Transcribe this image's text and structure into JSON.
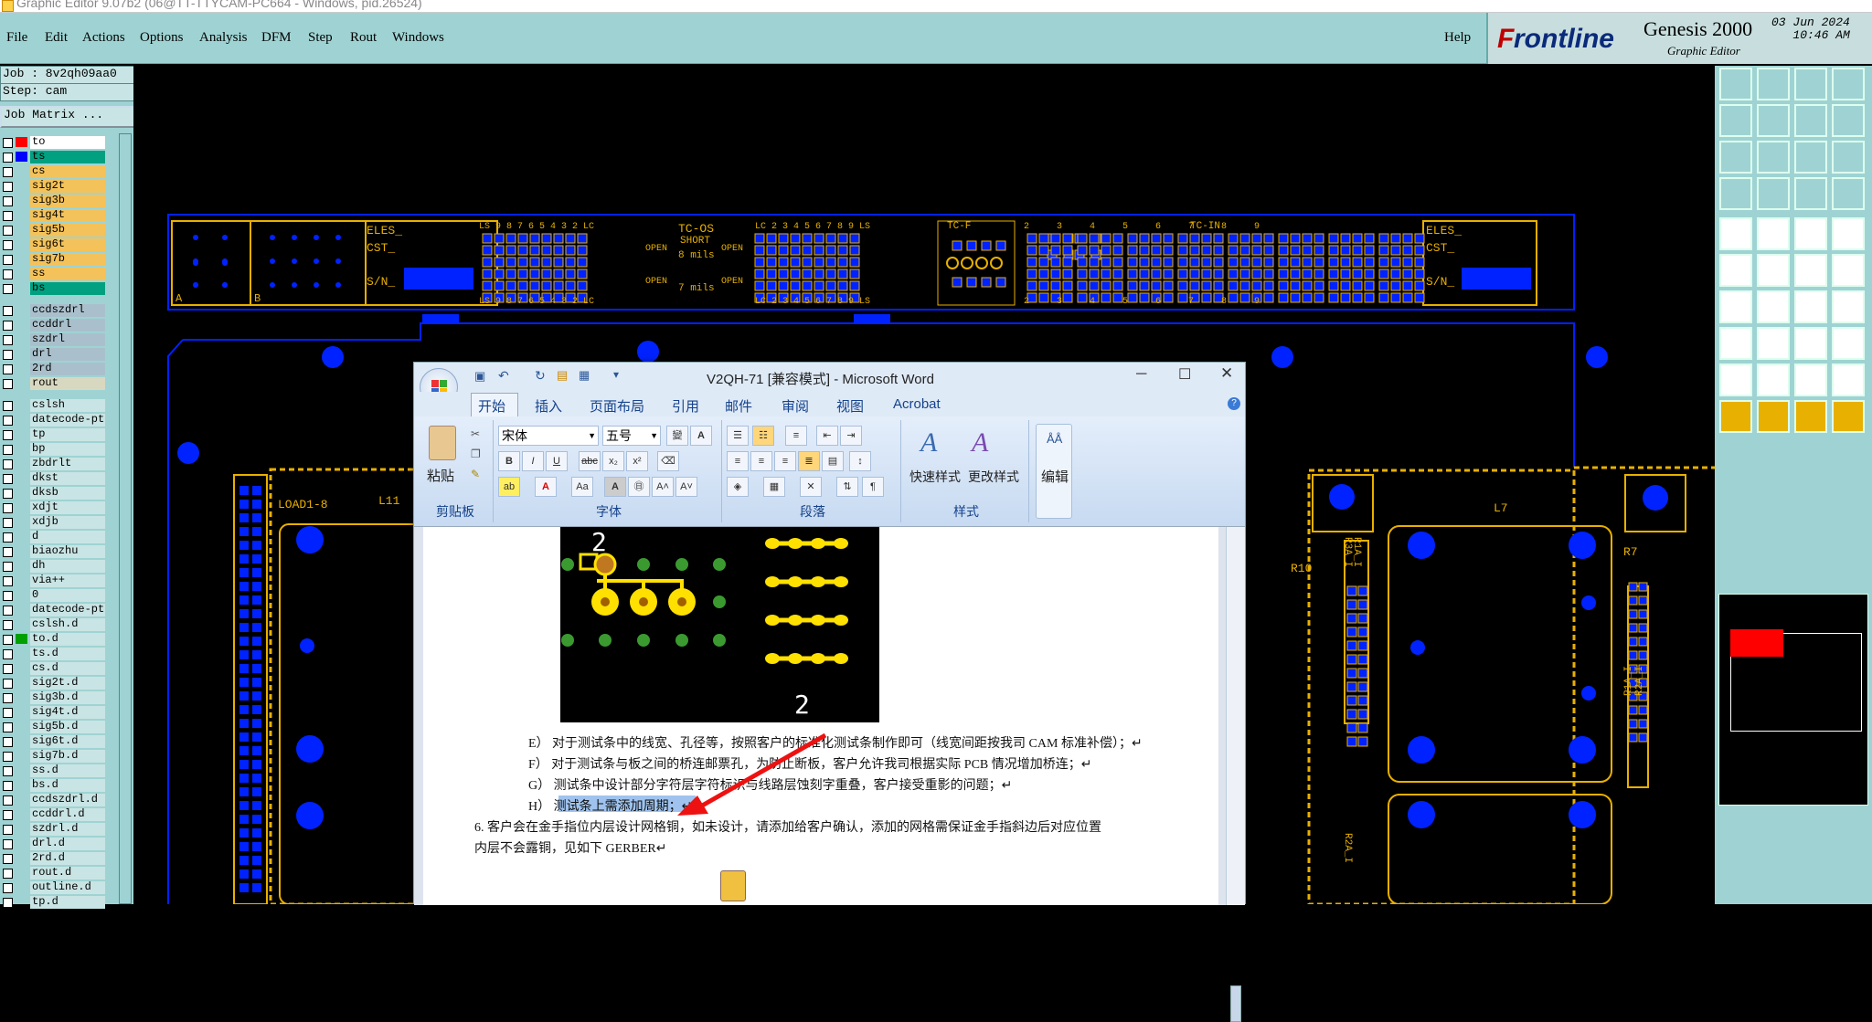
{
  "titlebar": {
    "text": "Graphic Editor 9.07b2 (06@TT-TTYCAM-PC664 - Windows, pid.26524)"
  },
  "menu": {
    "items": [
      "File",
      "Edit",
      "Actions",
      "Options",
      "Analysis",
      "DFM",
      "Step",
      "Rout",
      "Windows"
    ],
    "help": "Help"
  },
  "brand": {
    "logo_f": "F",
    "logo_rest": "rontline",
    "product": "Genesis 2000",
    "subtitle": "Graphic Editor",
    "date": "03 Jun 2024",
    "time": "10:46 AM"
  },
  "job": {
    "job_label": "Job : 8v2qh09aa0",
    "step_label": "Step: cam",
    "matrix_button": "Job Matrix ..."
  },
  "layers": [
    {
      "name": "to",
      "color": "#ffffff",
      "swatch": "#ff0000"
    },
    {
      "name": "ts",
      "color": "#00a080",
      "swatch": "#0000ff"
    },
    {
      "name": "cs",
      "color": "#f4c25a"
    },
    {
      "name": "sig2t",
      "color": "#f4c25a"
    },
    {
      "name": "sig3b",
      "color": "#f4c25a"
    },
    {
      "name": "sig4t",
      "color": "#f4c25a"
    },
    {
      "name": "sig5b",
      "color": "#f4c25a"
    },
    {
      "name": "sig6t",
      "color": "#f4c25a"
    },
    {
      "name": "sig7b",
      "color": "#f4c25a"
    },
    {
      "name": "ss",
      "color": "#f4c25a"
    },
    {
      "name": "bs",
      "color": "#00a080"
    },
    {
      "name": "ccdszdrl",
      "color": "#a9c0cc"
    },
    {
      "name": "ccddrl",
      "color": "#a9c0cc"
    },
    {
      "name": "szdrl",
      "color": "#a9c0cc"
    },
    {
      "name": "drl",
      "color": "#a9c0cc"
    },
    {
      "name": "2rd",
      "color": "#a9c0cc"
    },
    {
      "name": "rout",
      "color": "#d8d8c0"
    },
    {
      "name": "cslsh",
      "color": "#c9e4e4"
    },
    {
      "name": "datecode-ptc",
      "color": "#c9e4e4"
    },
    {
      "name": "tp",
      "color": "#c9e4e4"
    },
    {
      "name": "bp",
      "color": "#c9e4e4"
    },
    {
      "name": "zbdrlt",
      "color": "#c9e4e4"
    },
    {
      "name": "dkst",
      "color": "#c9e4e4"
    },
    {
      "name": "dksb",
      "color": "#c9e4e4"
    },
    {
      "name": "xdjt",
      "color": "#c9e4e4"
    },
    {
      "name": "xdjb",
      "color": "#c9e4e4"
    },
    {
      "name": "d",
      "color": "#c9e4e4"
    },
    {
      "name": "biaozhu",
      "color": "#c9e4e4"
    },
    {
      "name": "dh",
      "color": "#c9e4e4"
    },
    {
      "name": "via++",
      "color": "#c9e4e4"
    },
    {
      "name": "0",
      "color": "#c9e4e4"
    },
    {
      "name": "datecode-ptc",
      "color": "#c9e4e4"
    },
    {
      "name": "cslsh.d",
      "color": "#c9e4e4"
    },
    {
      "name": "to.d",
      "color": "#c9e4e4",
      "swatch": "#00a000"
    },
    {
      "name": "ts.d",
      "color": "#c9e4e4"
    },
    {
      "name": "cs.d",
      "color": "#c9e4e4"
    },
    {
      "name": "sig2t.d",
      "color": "#c9e4e4"
    },
    {
      "name": "sig3b.d",
      "color": "#c9e4e4"
    },
    {
      "name": "sig4t.d",
      "color": "#c9e4e4"
    },
    {
      "name": "sig5b.d",
      "color": "#c9e4e4"
    },
    {
      "name": "sig6t.d",
      "color": "#c9e4e4"
    },
    {
      "name": "sig7b.d",
      "color": "#c9e4e4"
    },
    {
      "name": "ss.d",
      "color": "#c9e4e4"
    },
    {
      "name": "bs.d",
      "color": "#c9e4e4"
    },
    {
      "name": "ccdszdrl.d",
      "color": "#c9e4e4"
    },
    {
      "name": "ccddrl.d",
      "color": "#c9e4e4"
    },
    {
      "name": "szdrl.d",
      "color": "#c9e4e4"
    },
    {
      "name": "drl.d",
      "color": "#c9e4e4"
    },
    {
      "name": "2rd.d",
      "color": "#c9e4e4"
    },
    {
      "name": "rout.d",
      "color": "#c9e4e4"
    },
    {
      "name": "outline.d",
      "color": "#c9e4e4"
    },
    {
      "name": "tp.d",
      "color": "#c9e4e4"
    }
  ],
  "canvas": {
    "labels": {
      "eles1": "ELES_",
      "cst1": "CST_",
      "sn1": "S/N_",
      "eles2": "ELES_",
      "cst2": "CST_",
      "sn2": "S/N_",
      "a": "A",
      "b": "B",
      "tcos": "TC-OS",
      "short": "SHORT",
      "mils8": "8 mils",
      "mils7": "7 mils",
      "open1": "OPEN",
      "open2": "OPEN",
      "open3": "OPEN",
      "open4": "OPEN",
      "tcf": "TC-F",
      "tcin": "TC-IN",
      "nums_left": "LS 9 8 7 6 5 4 3 2 LC",
      "nums_mid": "LC 2 3 4 5 6 7 8 9 LS",
      "nums_right": "2     3     4     5     6     7     8     9",
      "load": "LOAD1-8",
      "l11": "L11",
      "l7": "L7",
      "r10": "R10",
      "r7": "R7",
      "r3a": "R3A_I",
      "r1a": "R1A_I",
      "r1a2": "R1A_I",
      "r2a": "R2A_I",
      "r2a2": "R2A_I"
    }
  },
  "word": {
    "title": "V2QH-71 [兼容模式] - Microsoft Word",
    "tabs": [
      "开始",
      "插入",
      "页面布局",
      "引用",
      "邮件",
      "审阅",
      "视图",
      "Acrobat"
    ],
    "font_name": "宋体",
    "font_size": "五号",
    "paste_label": "粘贴",
    "quick_style": "快速样式",
    "change_style": "更改样式",
    "edit_label": "编辑",
    "groups": [
      "剪贴板",
      "字体",
      "段落",
      "样式"
    ],
    "img_num_top": "2",
    "img_num_bottom": "2",
    "lines": [
      "E） 对于测试条中的线宽、孔径等，按照客户的标准化测试条制作即可（线宽间距按我司 CAM 标准补偿）；↵",
      "F） 对于测试条与板之间的桥连邮票孔，为防止断板，客户允许我司根据实际 PCB 情况增加桥连；↵",
      "G） 测试条中设计部分字符层字符标识与线路层蚀刻字重叠，客户接受重影的问题；↵",
      "H） 测试条上需添加周期；↵",
      "6.  客户会在金手指位内层设计网格铜，如未设计，请添加给客户确认，添加的网格需保证金手指斜边后对应位置",
      "内层不会露铜，见如下 GERBER↵"
    ]
  },
  "colors": {
    "accent": "#e8b000",
    "pad": "#0022ff",
    "teal": "#9fd3d3",
    "red": "#ff0000"
  }
}
